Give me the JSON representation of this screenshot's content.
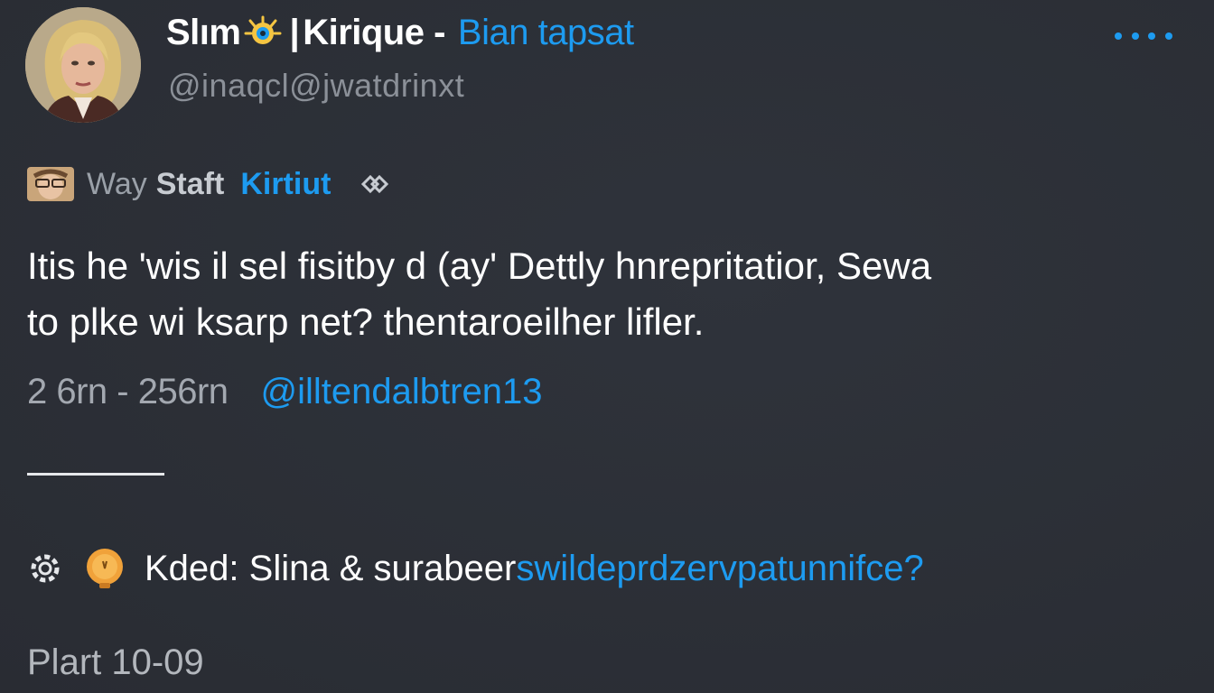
{
  "header": {
    "display_name_start": "Slım",
    "display_name_end": "Kirique -",
    "display_name_tag": "Bian tapsat",
    "handle": "@inaqcl@jwatdrinxt",
    "more_icon": "more-horizontal-icon"
  },
  "context": {
    "prefix": "Way",
    "bold": "Staft",
    "link": "Kirtiut",
    "share_icon": "share-icon"
  },
  "post": {
    "text": "Itis he 'wis il sel fisitby d (ay' Dettly hnrepritatior, Sewa\nto plke wi ksarp net? thentaroeilher lifler."
  },
  "meta": {
    "time": "2 6rn - 256rn",
    "mention": "@illtendalbtren13"
  },
  "actions": {
    "label": "Kded: Slina & surabeer",
    "link": "swildeprdzervpatunnifce?"
  },
  "footer": {
    "text": "Plart 10-09"
  },
  "colors": {
    "background": "#2c3038",
    "accent": "#1d9bf0",
    "text_primary": "#ffffff",
    "text_secondary": "#8b9098"
  }
}
